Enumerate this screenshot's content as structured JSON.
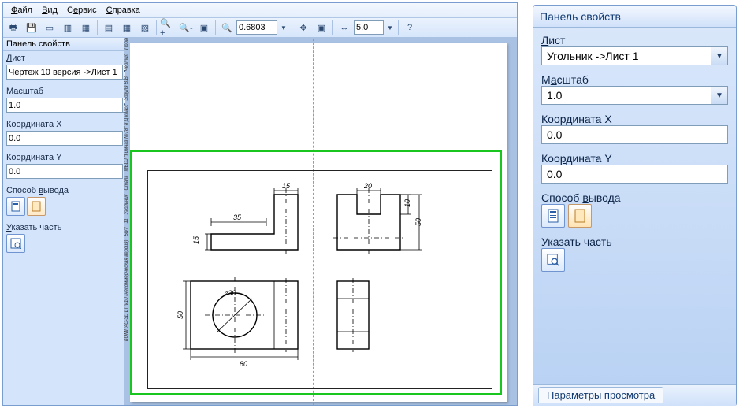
{
  "menu": {
    "file": "Файл",
    "view": "Вид",
    "service": "Сервис",
    "help": "Справка"
  },
  "toolbar": {
    "zoom_value": "0.6803",
    "step_value": "5.0"
  },
  "left_panel": {
    "title": "Панель свойств",
    "sheet_label": "Лист",
    "sheet_value": "Чертеж 10 версия ->Лист 1",
    "scale_label": "Масштаб",
    "scale_value": "1.0",
    "coordx_label": "Координата X",
    "coordx_value": "0.0",
    "coordy_label": "Координата Y",
    "coordy_value": "0.0",
    "output_label": "Способ вывода",
    "part_label": "Указать часть"
  },
  "right_panel": {
    "title": "Панель свойств",
    "sheet_label": "Лист",
    "sheet_value": "Угольник ->Лист 1",
    "scale_label": "Масштаб",
    "scale_value": "1.0",
    "coordx_label": "Координата X",
    "coordx_value": "0.0",
    "coordy_label": "Координата Y",
    "coordy_value": "0.0",
    "output_label": "Способ вывода",
    "part_label": "Указать часть",
    "tab": "Параметры просмотра"
  },
  "drawing_dims": {
    "d15": "15",
    "d20": "20",
    "d35": "35",
    "d10": "10",
    "d50v": "50",
    "d15v": "15",
    "d50": "50",
    "d80": "80",
    "dia30": "⌀30"
  }
}
